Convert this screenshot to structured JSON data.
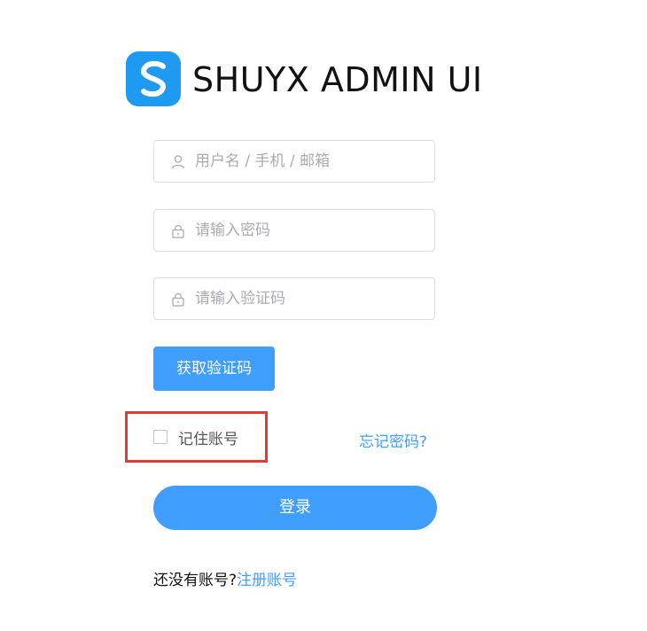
{
  "brand": {
    "title": "SHUYX ADMIN UI",
    "logo_color": "#1e9bf0",
    "logo_icon": "s-logo-icon"
  },
  "form": {
    "username": {
      "placeholder": "用户名 / 手机 / 邮箱",
      "value": "",
      "icon": "user-icon"
    },
    "password": {
      "placeholder": "请输入密码",
      "value": "",
      "icon": "lock-icon"
    },
    "captcha": {
      "placeholder": "请输入验证码",
      "value": "",
      "icon": "lock-icon"
    },
    "get_code_label": "获取验证码",
    "remember_label": "记住账号",
    "remember_checked": false,
    "forgot_label": "忘记密码?",
    "login_label": "登录"
  },
  "footer": {
    "no_account_text": "还没有账号?",
    "register_label": "注册账号"
  },
  "colors": {
    "primary": "#409eff",
    "highlight": "#e53935",
    "border": "#dcdfe6",
    "placeholder": "#a8abb2"
  }
}
